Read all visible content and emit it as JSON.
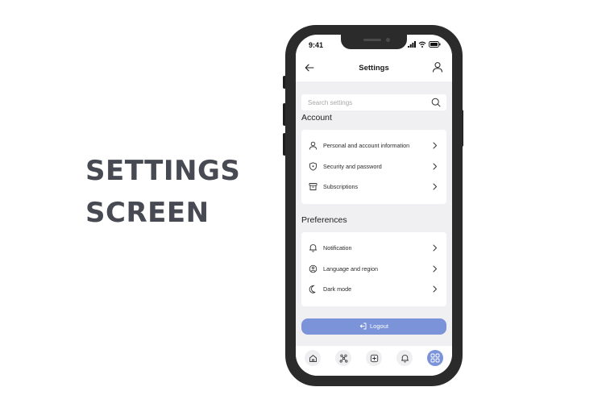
{
  "hero": {
    "line1": "SETTINGS",
    "line2": "SCREEN"
  },
  "status": {
    "time": "9:41"
  },
  "appbar": {
    "title": "Settings",
    "back_icon": "arrow-left-icon",
    "profile_icon": "user-icon"
  },
  "search": {
    "placeholder": "Search settings",
    "icon": "search-icon"
  },
  "sections": {
    "account": {
      "title": "Account",
      "items": [
        {
          "label": "Personal and account information",
          "icon": "user-icon"
        },
        {
          "label": "Security and password",
          "icon": "shield-icon"
        },
        {
          "label": "Subscriptions",
          "icon": "archive-icon"
        }
      ]
    },
    "preferences": {
      "title": "Preferences",
      "items": [
        {
          "label": "Notification",
          "icon": "bell-icon"
        },
        {
          "label": "Language and region",
          "icon": "globe-icon"
        },
        {
          "label": "Dark mode",
          "icon": "moon-icon"
        }
      ]
    }
  },
  "logout": {
    "label": "Logout",
    "icon": "logout-icon"
  },
  "tabbar": {
    "tabs": [
      {
        "icon": "home-icon",
        "active": false
      },
      {
        "icon": "network-icon",
        "active": false
      },
      {
        "icon": "plus-square-icon",
        "active": false
      },
      {
        "icon": "bell-icon",
        "active": false
      },
      {
        "icon": "grid-icon",
        "active": true
      }
    ]
  },
  "colors": {
    "accent": "#7b93d8",
    "phone": "#2b2b2b",
    "screen_bg": "#f0f0f3",
    "hero_text": "#474a52"
  }
}
